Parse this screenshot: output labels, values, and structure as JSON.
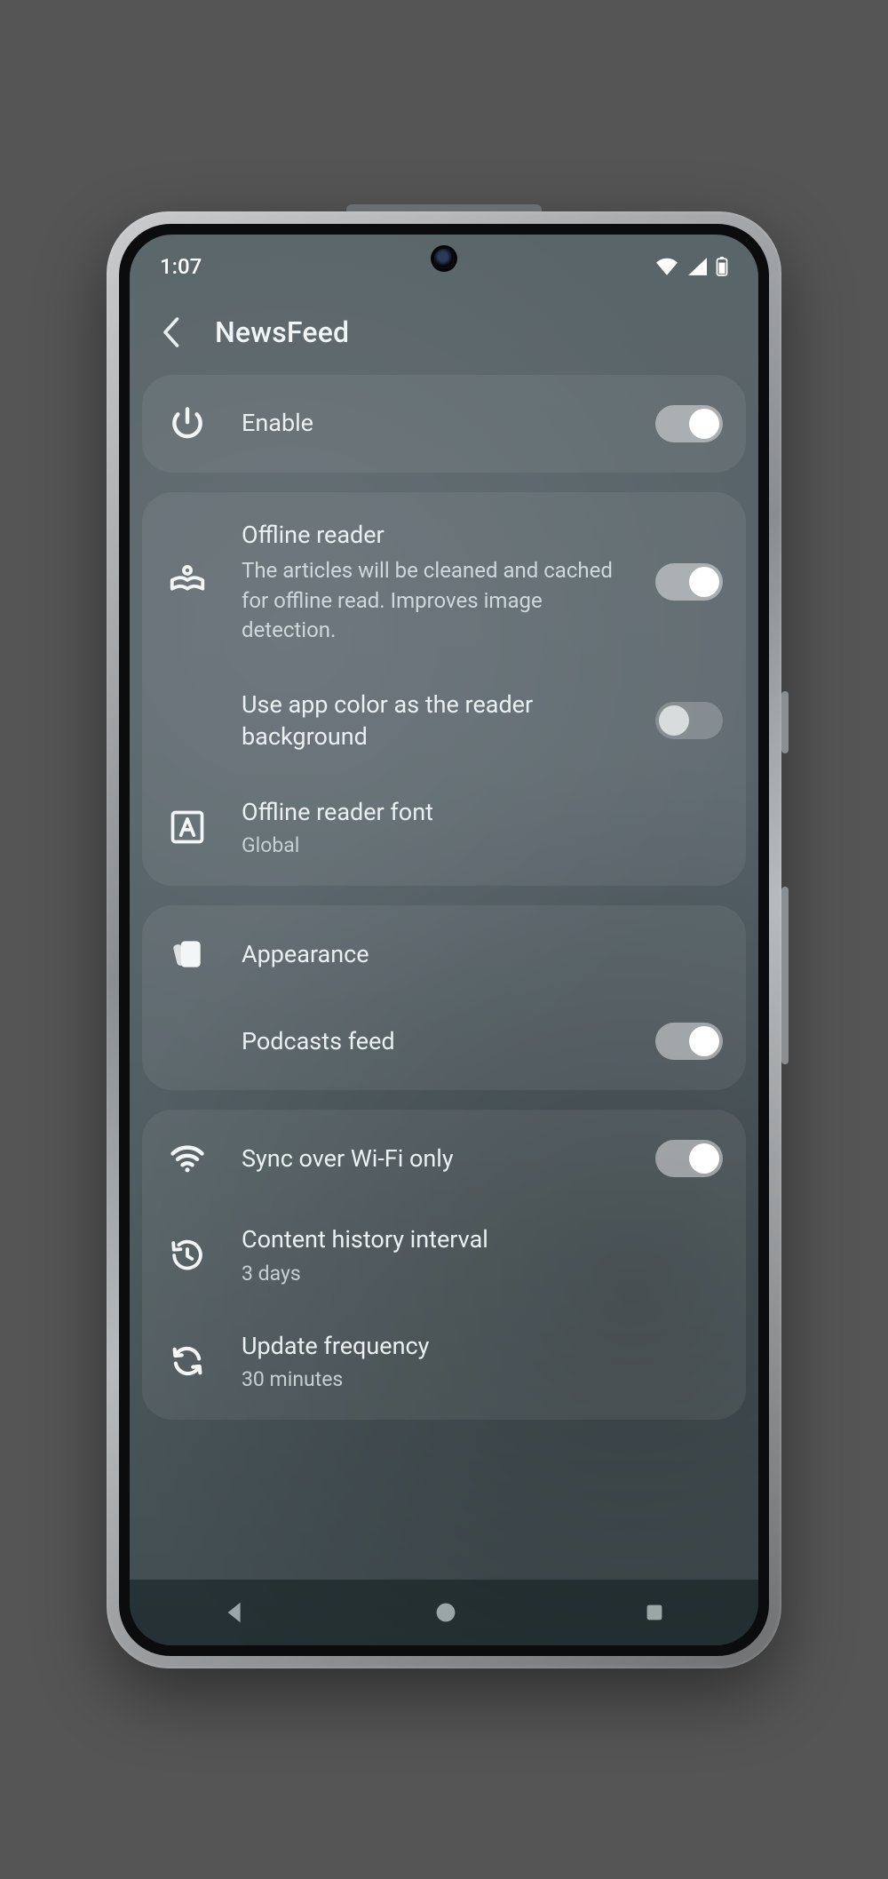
{
  "status": {
    "time": "1:07"
  },
  "header": {
    "title": "NewsFeed"
  },
  "rows": {
    "enable": {
      "label": "Enable",
      "on": true
    },
    "offline": {
      "label": "Offline reader",
      "desc": "The articles will be cleaned and cached for offline read. Improves image detection.",
      "on": true
    },
    "readerbg": {
      "label": "Use app color as the reader background",
      "on": false
    },
    "font": {
      "label": "Offline reader font",
      "sub": "Global"
    },
    "appearance": {
      "label": "Appearance"
    },
    "podcasts": {
      "label": "Podcasts feed",
      "on": true
    },
    "wifi": {
      "label": "Sync over Wi-Fi only",
      "on": true
    },
    "history": {
      "label": "Content history interval",
      "sub": "3 days"
    },
    "update": {
      "label": "Update frequency",
      "sub": "30 minutes"
    }
  }
}
